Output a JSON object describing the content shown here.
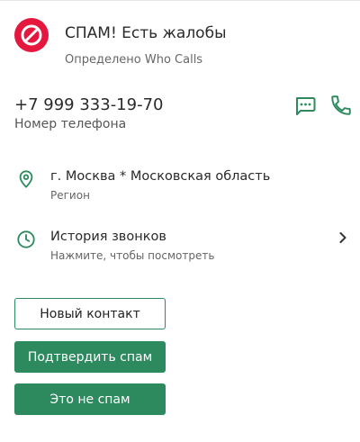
{
  "spam": {
    "title": "СПАМ! Есть жалобы",
    "source": "Определено Who Calls"
  },
  "phone": {
    "number": "+7 999 333-19-70",
    "label": "Номер телефона"
  },
  "region": {
    "value": "г. Москва * Московская область",
    "label": "Регион"
  },
  "history": {
    "title": "История звонков",
    "hint": "Нажмите, чтобы посмотреть"
  },
  "buttons": {
    "new_contact": "Новый контакт",
    "confirm_spam": "Подтвердить спам",
    "not_spam": "Это не спам"
  },
  "icons": {
    "spam": "block-icon",
    "message": "message-icon",
    "call": "phone-icon",
    "location": "location-pin-icon",
    "history": "clock-icon",
    "chevron": "chevron-right-icon"
  },
  "colors": {
    "spam_red": "#e5173f",
    "accent_green": "#2d8a5e",
    "text_primary": "#2a2a2a",
    "text_secondary": "#666666"
  }
}
